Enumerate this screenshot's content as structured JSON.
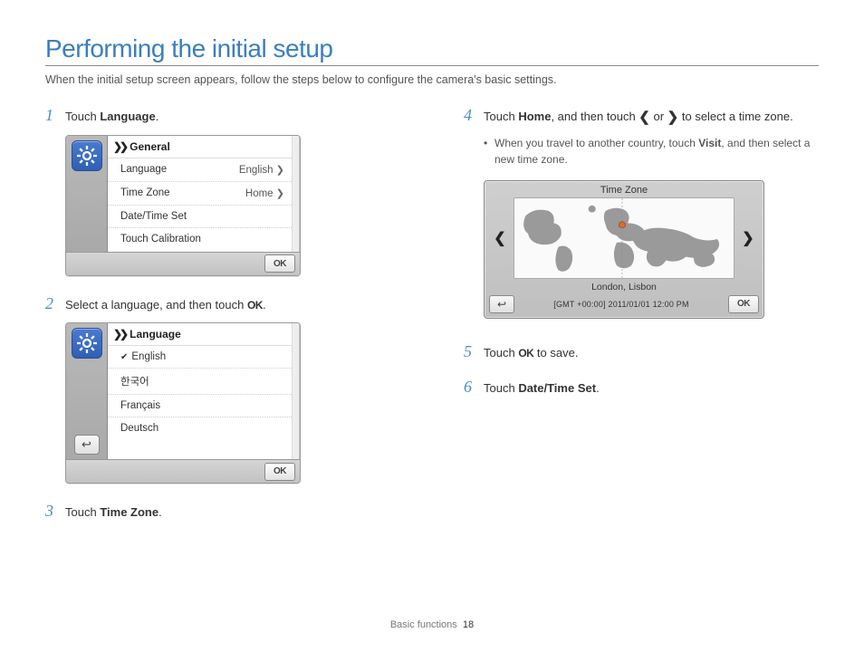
{
  "title": "Performing the initial setup",
  "subtitle": "When the initial setup screen appears, follow the steps below to configure the camera's basic settings.",
  "steps": {
    "s1": {
      "num": "1",
      "pre": "Touch ",
      "bold": "Language",
      "post": "."
    },
    "s2": {
      "num": "2",
      "pre": "Select a language, and then touch ",
      "ok": "OK",
      "post": "."
    },
    "s3": {
      "num": "3",
      "pre": "Touch ",
      "bold": "Time Zone",
      "post": "."
    },
    "s4": {
      "num": "4",
      "pre": "Touch ",
      "bold": "Home",
      "mid": ", and then touch ",
      "post_after_icons": " to select a time zone."
    },
    "s4_bullet": {
      "pre": "When you travel to another country, touch ",
      "bold": "Visit",
      "post": ", and then select a new time zone."
    },
    "s5": {
      "num": "5",
      "pre": "Touch ",
      "ok": "OK",
      "post": " to save."
    },
    "s6": {
      "num": "6",
      "pre": "Touch ",
      "bold": "Date/Time Set",
      "post": "."
    }
  },
  "panel_general": {
    "header": "General",
    "items": [
      {
        "label": "Language",
        "value": "English",
        "chevron": true
      },
      {
        "label": "Time Zone",
        "value": "Home",
        "chevron": true
      },
      {
        "label": "Date/Time Set",
        "value": "",
        "chevron": false
      },
      {
        "label": "Touch Calibration",
        "value": "",
        "chevron": false
      }
    ],
    "ok": "OK"
  },
  "panel_language": {
    "header": "Language",
    "items": [
      {
        "label": "English",
        "checked": true
      },
      {
        "label": "한국어",
        "checked": false
      },
      {
        "label": "Français",
        "checked": false
      },
      {
        "label": "Deutsch",
        "checked": false
      }
    ],
    "ok": "OK"
  },
  "panel_timezone": {
    "title": "Time Zone",
    "city": "London, Lisbon",
    "gmt": "[GMT +00:00] 2011/01/01 12:00 PM",
    "ok": "OK"
  },
  "footer": {
    "section": "Basic functions",
    "page": "18"
  },
  "glyphs": {
    "or": " or ",
    "chev_left": "❮",
    "chev_right": "❯"
  }
}
